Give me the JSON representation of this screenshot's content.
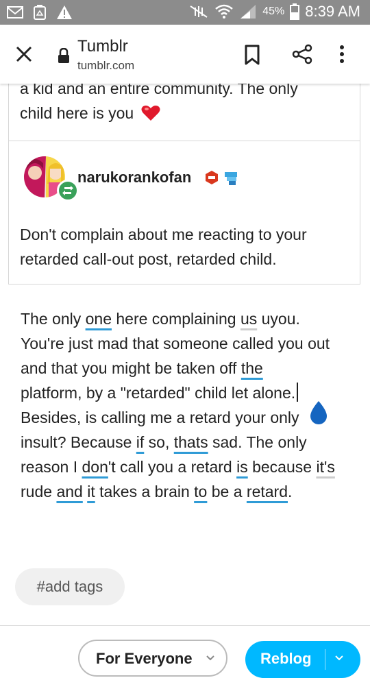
{
  "status_bar": {
    "battery_percent": "45%",
    "time": "8:39 AM",
    "icons": [
      "mail-icon",
      "recycle-icon",
      "warning-icon",
      "nfc-mute-icon",
      "wifi-icon",
      "signal-icon",
      "battery-icon"
    ]
  },
  "browser": {
    "title": "Tumblr",
    "url": "tumblr.com",
    "icons": [
      "close-icon",
      "lock-icon",
      "bookmark-icon",
      "share-icon",
      "more-vert-icon"
    ]
  },
  "thread": {
    "previous_text_line1": "a kid and an entire community. The only",
    "previous_text_line2": "child here is you",
    "previous_emoji": "heart-icon",
    "post": {
      "username": "narukorankofan",
      "body_line1": "Don't complain about me reacting to your",
      "body_line2": "retarded call-out post, retarded child."
    }
  },
  "reply": {
    "l1_a": "The only ",
    "l1_w1": "one",
    "l1_b": " here complaining ",
    "l1_w2": "us",
    "l1_c": " uyou.",
    "l2": "You're just mad that someone called you out",
    "l3_a": "and that you might be taken off ",
    "l3_w1": "the",
    "l4": "platform, by a \"retarded\" child let alone.",
    "l5": "Besides, is calling me a retard your only",
    "l6_a": "insult? Because ",
    "l6_w1": "if",
    "l6_b": " so, ",
    "l6_w2": "thats",
    "l6_c": " sad. The only",
    "l7_a": "reason I ",
    "l7_w1": "don",
    "l7_b": "'t call you a retard ",
    "l7_w2": "is",
    "l7_c": " because ",
    "l7_w3": "it's",
    "l8_a": "rude ",
    "l8_w1": "and",
    "l8_b": " ",
    "l8_w2": "it",
    "l8_c": " takes a brain ",
    "l8_w3": "to",
    "l8_d": " be a ",
    "l8_w4": "retard",
    "l8_e": "."
  },
  "tags_placeholder": "#add tags",
  "footer": {
    "audience_label": "For Everyone",
    "reblog_label": "Reblog"
  },
  "colors": {
    "status_bar": "#8c8c8c",
    "reblog_button": "#00b8ff",
    "spellcheck_underline": "#2f9bd6",
    "cursor_handle": "#1565c0",
    "reblog_badge": "#3aa15a"
  }
}
